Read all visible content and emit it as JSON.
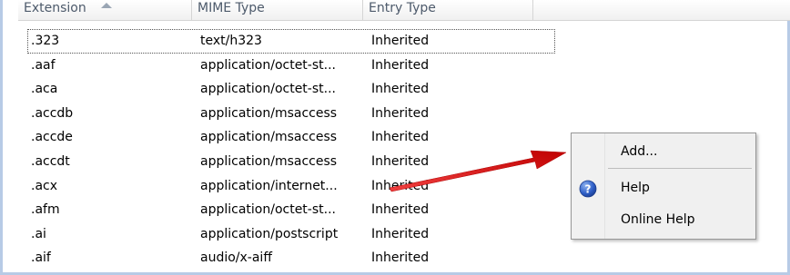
{
  "columns": {
    "extension": "Extension",
    "mime": "MIME Type",
    "entry": "Entry Type"
  },
  "rows": [
    {
      "ext": ".323",
      "mime": "text/h323",
      "entry": "Inherited"
    },
    {
      "ext": ".aaf",
      "mime": "application/octet-st...",
      "entry": "Inherited"
    },
    {
      "ext": ".aca",
      "mime": "application/octet-st...",
      "entry": "Inherited"
    },
    {
      "ext": ".accdb",
      "mime": "application/msaccess",
      "entry": "Inherited"
    },
    {
      "ext": ".accde",
      "mime": "application/msaccess",
      "entry": "Inherited"
    },
    {
      "ext": ".accdt",
      "mime": "application/msaccess",
      "entry": "Inherited"
    },
    {
      "ext": ".acx",
      "mime": "application/internet...",
      "entry": "Inherited"
    },
    {
      "ext": ".afm",
      "mime": "application/octet-st...",
      "entry": "Inherited"
    },
    {
      "ext": ".ai",
      "mime": "application/postscript",
      "entry": "Inherited"
    },
    {
      "ext": ".aif",
      "mime": "audio/x-aiff",
      "entry": "Inherited"
    }
  ],
  "context_menu": {
    "add": "Add...",
    "help": "Help",
    "online_help": "Online Help",
    "help_icon": "help-icon"
  },
  "annotation": {
    "arrow_color": "#e02020"
  }
}
